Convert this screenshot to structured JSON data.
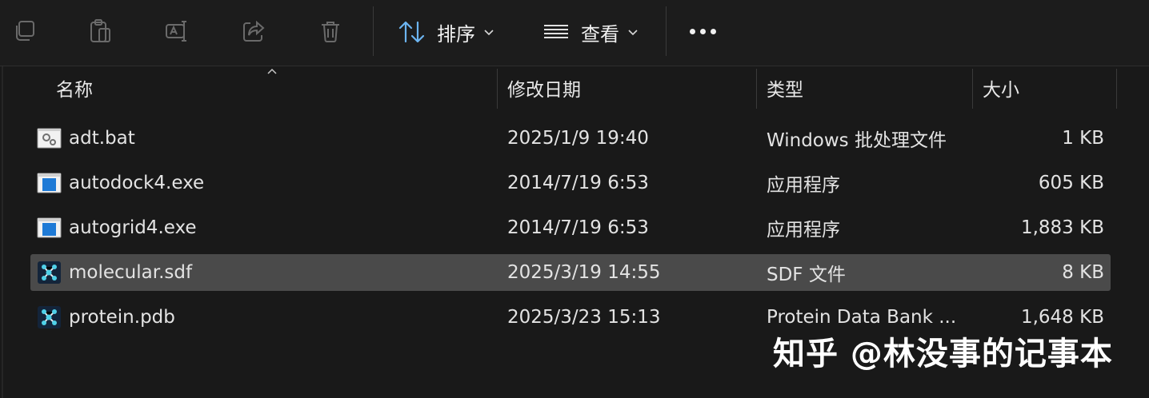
{
  "toolbar": {
    "icons": [
      "copy-icon",
      "paste-icon",
      "rename-icon",
      "share-icon",
      "delete-icon"
    ],
    "sort_label": "排序",
    "view_label": "查看",
    "more_icon": "more-icon"
  },
  "columns": {
    "name": "名称",
    "modified": "修改日期",
    "type": "类型",
    "size": "大小"
  },
  "files": [
    {
      "name": "adt.bat",
      "modified": "2025/1/9 19:40",
      "type": "Windows 批处理文件",
      "size": "1 KB",
      "icon": "batch-file-icon",
      "selected": false
    },
    {
      "name": "autodock4.exe",
      "modified": "2014/7/19 6:53",
      "type": "应用程序",
      "size": "605 KB",
      "icon": "application-icon",
      "selected": false
    },
    {
      "name": "autogrid4.exe",
      "modified": "2014/7/19 6:53",
      "type": "应用程序",
      "size": "1,883 KB",
      "icon": "application-icon",
      "selected": false
    },
    {
      "name": "molecular.sdf",
      "modified": "2025/3/19 14:55",
      "type": "SDF 文件",
      "size": "8 KB",
      "icon": "molecule-file-icon",
      "selected": true
    },
    {
      "name": "protein.pdb",
      "modified": "2025/3/23 15:13",
      "type": "Protein Data Bank ...",
      "size": "1,648 KB",
      "icon": "molecule-file-icon",
      "selected": false
    }
  ],
  "watermark": "知乎 @林没事的记事本",
  "colors": {
    "background": "#191919",
    "selected_row": "#4a4a4a",
    "accent_blue": "#1e7ad6",
    "molecule_cyan": "#4fd0e8"
  }
}
